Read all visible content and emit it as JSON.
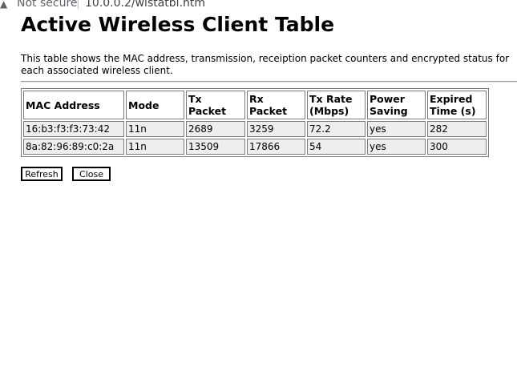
{
  "browser": {
    "security_label": "Not secure",
    "separator": "|",
    "url": "10.0.0.2/wlstatbl.htm",
    "warning_icon": "warning-triangle-icon"
  },
  "page": {
    "title": "Active Wireless Client Table",
    "description": "This table shows the MAC address, transmission, receiption packet counters and encrypted status for each associated wireless client."
  },
  "table": {
    "headers": [
      "MAC Address",
      "Mode",
      "Tx Packet",
      "Rx Packet",
      "Tx Rate (Mbps)",
      "Power Saving",
      "Expired Time (s)"
    ],
    "rows": [
      [
        "16:b3:f3:f3:73:42",
        "11n",
        "2689",
        "3259",
        "72.2",
        "yes",
        "282"
      ],
      [
        "8a:82:96:89:c0:2a",
        "11n",
        "13509",
        "17866",
        "54",
        "yes",
        "300"
      ]
    ]
  },
  "buttons": {
    "refresh_label": "Refresh",
    "close_label": "Close"
  }
}
